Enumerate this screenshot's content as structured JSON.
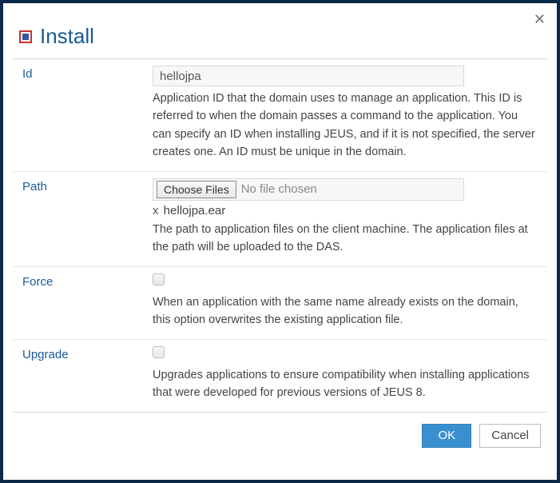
{
  "title": "Install",
  "fields": {
    "id": {
      "label": "Id",
      "value": "hellojpa",
      "desc": "Application ID that the domain uses to manage an application. This ID is referred to when the domain passes a command to the application. You can specify an ID when installing JEUS, and if it is not specified, the server creates one. An ID must be unique in the domain."
    },
    "path": {
      "label": "Path",
      "choose_label": "Choose Files",
      "status": "No file chosen",
      "remove_prefix": "x",
      "selected_file": "hellojpa.ear",
      "desc": "The path to application files on the client machine. The application files at the path will be uploaded to the DAS."
    },
    "force": {
      "label": "Force",
      "desc": "When an application with the same name already exists on the domain, this option overwrites the existing application file."
    },
    "upgrade": {
      "label": "Upgrade",
      "desc": "Upgrades applications to ensure compatibility when installing applications that were developed for previous versions of JEUS 8."
    }
  },
  "buttons": {
    "ok": "OK",
    "cancel": "Cancel"
  }
}
